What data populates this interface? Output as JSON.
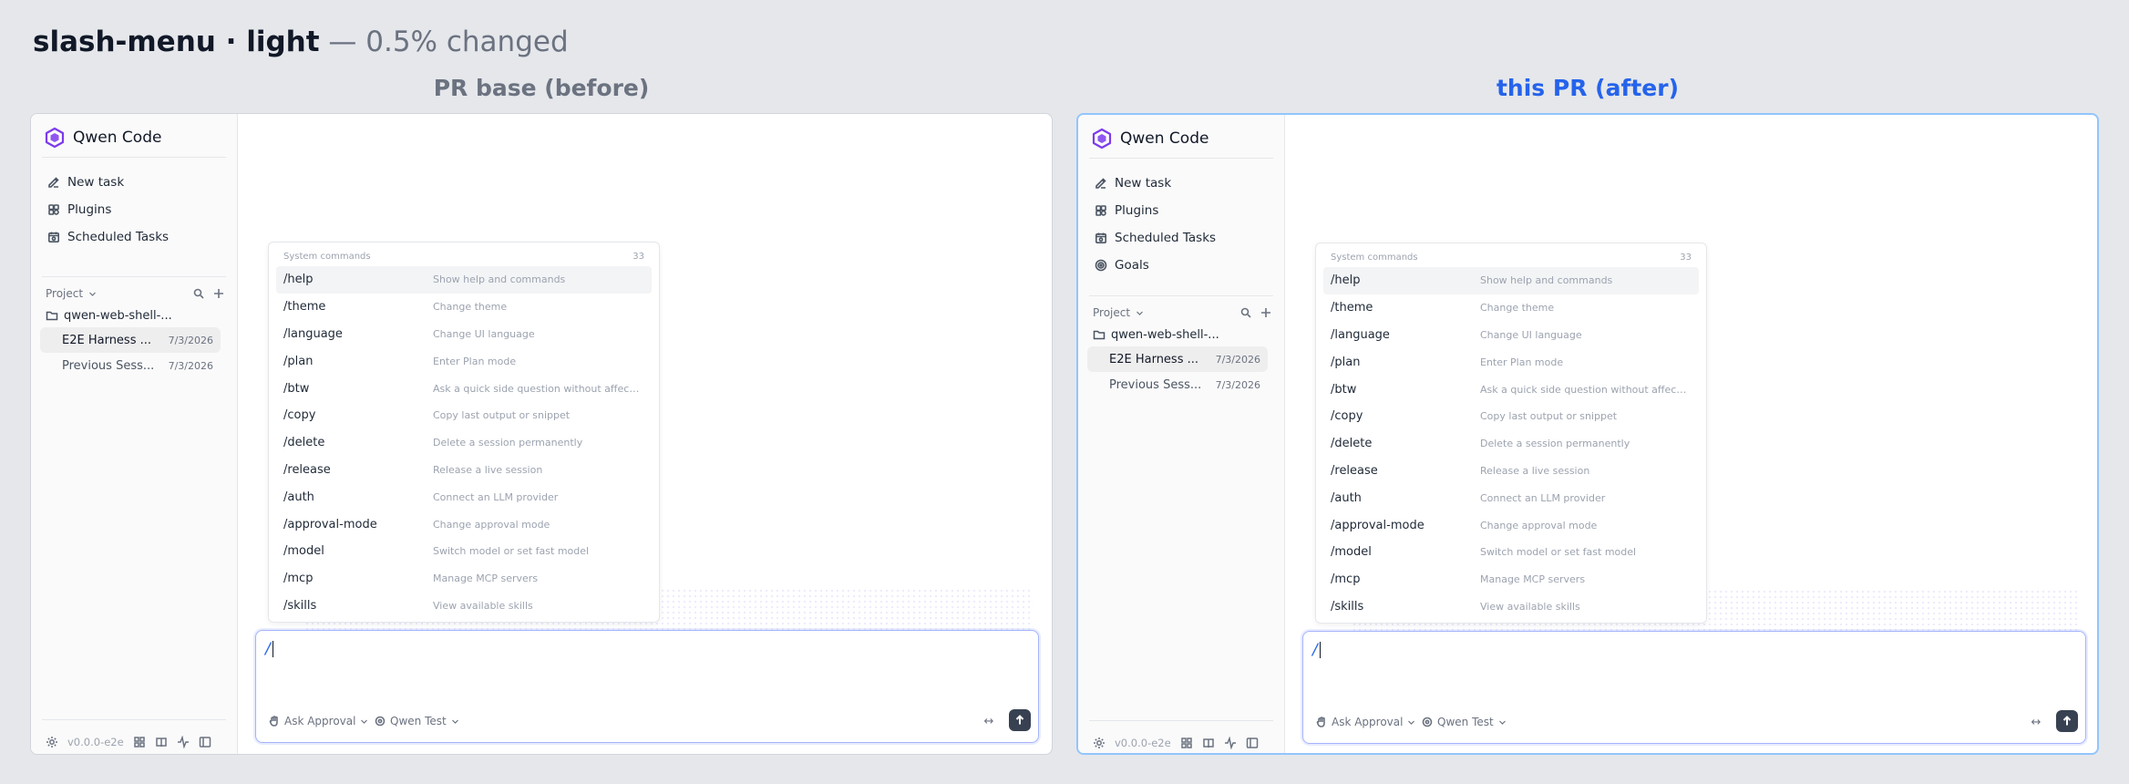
{
  "header": {
    "title_bold": "slash-menu · light",
    "title_suffix": "— 0.5% changed",
    "before_label": "PR base (before)",
    "after_label": "this PR (after)"
  },
  "app": {
    "name": "Qwen Code",
    "project_label": "Project",
    "folder": "qwen-web-shell-...",
    "version": "v0.0.0-e2e"
  },
  "nav_before": [
    {
      "label": "New task",
      "icon": "edit-icon"
    },
    {
      "label": "Plugins",
      "icon": "plugins-icon"
    },
    {
      "label": "Scheduled Tasks",
      "icon": "calendar-icon"
    }
  ],
  "nav_after": [
    {
      "label": "New task",
      "icon": "edit-icon"
    },
    {
      "label": "Plugins",
      "icon": "plugins-icon"
    },
    {
      "label": "Scheduled Tasks",
      "icon": "calendar-icon"
    },
    {
      "label": "Goals",
      "icon": "target-icon"
    }
  ],
  "sessions": [
    {
      "name": "E2E Harness ...",
      "date": "7/3/2026",
      "active": true
    },
    {
      "name": "Previous Sess...",
      "date": "7/3/2026",
      "active": false
    }
  ],
  "menu": {
    "section": "System commands",
    "count": "33",
    "commands": [
      {
        "name": "/help",
        "desc": "Show help and commands"
      },
      {
        "name": "/theme",
        "desc": "Change theme"
      },
      {
        "name": "/language",
        "desc": "Change UI language"
      },
      {
        "name": "/plan",
        "desc": "Enter Plan mode"
      },
      {
        "name": "/btw",
        "desc": "Ask a quick side question without affectin..."
      },
      {
        "name": "/copy",
        "desc": "Copy last output or snippet"
      },
      {
        "name": "/delete",
        "desc": "Delete a session permanently"
      },
      {
        "name": "/release",
        "desc": "Release a live session"
      },
      {
        "name": "/auth",
        "desc": "Connect an LLM provider"
      },
      {
        "name": "/approval-mode",
        "desc": "Change approval mode"
      },
      {
        "name": "/model",
        "desc": "Switch model or set fast model"
      },
      {
        "name": "/mcp",
        "desc": "Manage MCP servers"
      },
      {
        "name": "/skills",
        "desc": "View available skills"
      }
    ]
  },
  "composer": {
    "input_value": "/",
    "approval": "Ask Approval",
    "model": "Qwen Test",
    "expand_glyph": "↔"
  },
  "colors": {
    "accent": "#2563eb",
    "brand": "#7c3aed",
    "muted": "#6b7280"
  }
}
